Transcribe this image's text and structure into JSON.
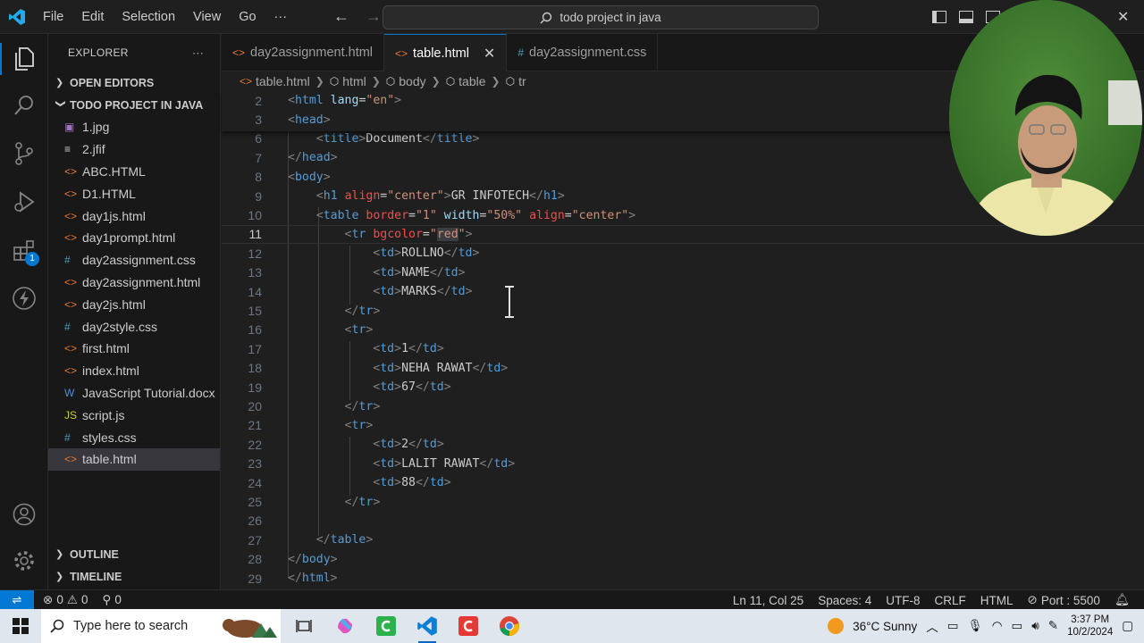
{
  "titlebar": {
    "menu": [
      "File",
      "Edit",
      "Selection",
      "View",
      "Go"
    ],
    "more": "···",
    "search_text": "todo project in java"
  },
  "activity": {
    "extensions_badge": "1"
  },
  "sidebar": {
    "explorer_title": "EXPLORER",
    "more": "···",
    "open_editors": "OPEN EDITORS",
    "project": "TODO PROJECT IN JAVA",
    "files": [
      {
        "name": "1.jpg",
        "icon": "image-icon",
        "glyph": "▣",
        "color": "#a074c4"
      },
      {
        "name": "2.jfif",
        "icon": "lines-icon",
        "glyph": "≡",
        "color": "#cccccc"
      },
      {
        "name": "ABC.HTML",
        "icon": "html-icon",
        "glyph": "<>",
        "color": "#e37933"
      },
      {
        "name": "D1.HTML",
        "icon": "html-icon",
        "glyph": "<>",
        "color": "#e37933"
      },
      {
        "name": "day1js.html",
        "icon": "html-icon",
        "glyph": "<>",
        "color": "#e37933"
      },
      {
        "name": "day1prompt.html",
        "icon": "html-icon",
        "glyph": "<>",
        "color": "#e37933"
      },
      {
        "name": "day2assignment.css",
        "icon": "css-icon",
        "glyph": "#",
        "color": "#519aba"
      },
      {
        "name": "day2assignment.html",
        "icon": "html-icon",
        "glyph": "<>",
        "color": "#e37933"
      },
      {
        "name": "day2js.html",
        "icon": "html-icon",
        "glyph": "<>",
        "color": "#e37933"
      },
      {
        "name": "day2style.css",
        "icon": "css-icon",
        "glyph": "#",
        "color": "#519aba"
      },
      {
        "name": "first.html",
        "icon": "html-icon",
        "glyph": "<>",
        "color": "#e37933"
      },
      {
        "name": "index.html",
        "icon": "html-icon",
        "glyph": "<>",
        "color": "#e37933"
      },
      {
        "name": "JavaScript Tutorial.docx",
        "icon": "word-icon",
        "glyph": "W",
        "color": "#4a90d9"
      },
      {
        "name": "script.js",
        "icon": "js-icon",
        "glyph": "JS",
        "color": "#cbcb41"
      },
      {
        "name": "styles.css",
        "icon": "css-icon",
        "glyph": "#",
        "color": "#519aba"
      },
      {
        "name": "table.html",
        "icon": "html-icon",
        "glyph": "<>",
        "color": "#e37933"
      }
    ],
    "outline": "OUTLINE",
    "timeline": "TIMELINE"
  },
  "tabs": [
    {
      "label": "day2assignment.html",
      "glyph": "<>",
      "color": "#e37933"
    },
    {
      "label": "table.html",
      "glyph": "<>",
      "color": "#e37933"
    },
    {
      "label": "day2assignment.css",
      "glyph": "#",
      "color": "#519aba"
    }
  ],
  "tab_close": "✕",
  "breadcrumb": [
    "table.html",
    "html",
    "body",
    "table",
    "tr"
  ],
  "editor": {
    "lines": [
      {
        "n": "2",
        "html": "<span class='b'>&lt;</span><span class='t'>html</span> <span class='a2'>lang</span>=<span class='s'>\"en\"</span><span class='b'>&gt;</span>"
      },
      {
        "n": "3",
        "html": "<span class='b'>&lt;</span><span class='t'>head</span><span class='b'>&gt;</span>"
      },
      {
        "n": "6",
        "html": "    <span class='b'>&lt;</span><span class='t'>title</span><span class='b'>&gt;</span>Document<span class='b'>&lt;/</span><span class='t'>title</span><span class='b'>&gt;</span>"
      },
      {
        "n": "7",
        "html": "<span class='b'>&lt;/</span><span class='t'>head</span><span class='b'>&gt;</span>"
      },
      {
        "n": "8",
        "html": "<span class='b'>&lt;</span><span class='t'>body</span><span class='b'>&gt;</span>"
      },
      {
        "n": "9",
        "html": "    <span class='b'>&lt;</span><span class='t'>h1</span> <span class='a'>align</span>=<span class='s'>\"center\"</span><span class='b'>&gt;</span>GR INFOTECH<span class='b'>&lt;/</span><span class='t'>h1</span><span class='b'>&gt;</span>"
      },
      {
        "n": "10",
        "html": "    <span class='b'>&lt;</span><span class='t'>table</span> <span class='a'>border</span>=<span class='s'>\"1\"</span> <span class='a2'>width</span>=<span class='s'>\"50%\"</span> <span class='a'>align</span>=<span class='s'>\"center\"</span><span class='b'>&gt;</span>"
      },
      {
        "n": "11",
        "html": "        <span class='b'>&lt;</span><span class='t'>tr</span> <span class='a'>bgcolor</span>=<span class='s'>\"<span class='sel'>red</span>\"</span><span class='b'>&gt;</span>"
      },
      {
        "n": "12",
        "html": "            <span class='b'>&lt;</span><span class='t'>td</span><span class='b'>&gt;</span>ROLLNO<span class='b'>&lt;/</span><span class='t'>td</span><span class='b'>&gt;</span>"
      },
      {
        "n": "13",
        "html": "            <span class='b'>&lt;</span><span class='t'>td</span><span class='b'>&gt;</span>NAME<span class='b'>&lt;/</span><span class='t'>td</span><span class='b'>&gt;</span>"
      },
      {
        "n": "14",
        "html": "            <span class='b'>&lt;</span><span class='t'>td</span><span class='b'>&gt;</span>MARKS<span class='b'>&lt;/</span><span class='t'>td</span><span class='b'>&gt;</span>"
      },
      {
        "n": "15",
        "html": "        <span class='b'>&lt;/</span><span class='t'>tr</span><span class='b'>&gt;</span>"
      },
      {
        "n": "16",
        "html": "        <span class='b'>&lt;</span><span class='t'>tr</span><span class='b'>&gt;</span>"
      },
      {
        "n": "17",
        "html": "            <span class='b'>&lt;</span><span class='t'>td</span><span class='b'>&gt;</span>1<span class='b'>&lt;/</span><span class='t'>td</span><span class='b'>&gt;</span>"
      },
      {
        "n": "18",
        "html": "            <span class='b'>&lt;</span><span class='t'>td</span><span class='b'>&gt;</span>NEHA RAWAT<span class='b'>&lt;/</span><span class='t'>td</span><span class='b'>&gt;</span>"
      },
      {
        "n": "19",
        "html": "            <span class='b'>&lt;</span><span class='t'>td</span><span class='b'>&gt;</span>67<span class='b'>&lt;/</span><span class='t'>td</span><span class='b'>&gt;</span>"
      },
      {
        "n": "20",
        "html": "        <span class='b'>&lt;/</span><span class='t'>tr</span><span class='b'>&gt;</span>"
      },
      {
        "n": "21",
        "html": "        <span class='b'>&lt;</span><span class='t'>tr</span><span class='b'>&gt;</span>"
      },
      {
        "n": "22",
        "html": "            <span class='b'>&lt;</span><span class='t'>td</span><span class='b'>&gt;</span>2<span class='b'>&lt;/</span><span class='t'>td</span><span class='b'>&gt;</span>"
      },
      {
        "n": "23",
        "html": "            <span class='b'>&lt;</span><span class='t'>td</span><span class='b'>&gt;</span>LALIT RAWAT<span class='b'>&lt;/</span><span class='t'>td</span><span class='b'>&gt;</span>"
      },
      {
        "n": "24",
        "html": "            <span class='b'>&lt;</span><span class='t'>td</span><span class='b'>&gt;</span>88<span class='b'>&lt;/</span><span class='t'>td</span><span class='b'>&gt;</span>"
      },
      {
        "n": "25",
        "html": "        <span class='b'>&lt;/</span><span class='t'>tr</span><span class='b'>&gt;</span>"
      },
      {
        "n": "26",
        "html": ""
      },
      {
        "n": "27",
        "html": "    <span class='b'>&lt;/</span><span class='t'>table</span><span class='b'>&gt;</span>"
      },
      {
        "n": "28",
        "html": "<span class='b'>&lt;/</span><span class='t'>body</span><span class='b'>&gt;</span>"
      },
      {
        "n": "29",
        "html": "<span class='b'>&lt;/</span><span class='t'>html</span><span class='b'>&gt;</span>"
      }
    ],
    "current_line": "11"
  },
  "statusbar": {
    "errors": "0",
    "warnings": "0",
    "ports": "0",
    "position": "Ln 11, Col 25",
    "spaces": "Spaces: 4",
    "encoding": "UTF-8",
    "eol": "CRLF",
    "language": "HTML",
    "port": "Port : 5500"
  },
  "taskbar": {
    "search_placeholder": "Type here to search",
    "weather": "36°C  Sunny",
    "time": "3:37 PM",
    "date": "10/2/2024"
  }
}
